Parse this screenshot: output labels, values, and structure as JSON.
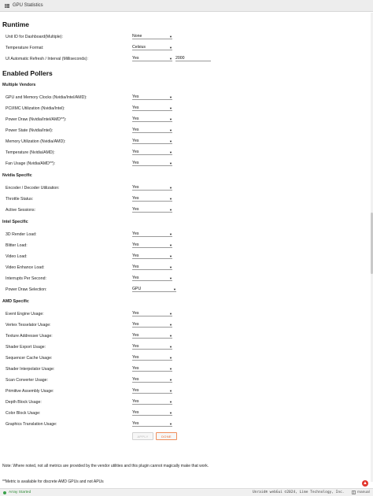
{
  "window": {
    "title": "GPU Statistics"
  },
  "runtime": {
    "heading": "Runtime",
    "rows": [
      {
        "label": "Unit ID for Dashboard(Multiple):",
        "value": "None"
      },
      {
        "label": "Temperature Format:",
        "value": "Celsius"
      },
      {
        "label": "UI Automatic Refresh / Interval (Milliseconds):",
        "value": "Yes",
        "interval": "2000"
      }
    ]
  },
  "pollers": {
    "heading": "Enabled Pollers",
    "multiple": {
      "heading": "Multiple Vendors",
      "rows": [
        {
          "label": "GPU and Memory Clocks (Nvidia/Intel/AMD):",
          "value": "Yes"
        },
        {
          "label": "PCI/IMC Utilization (Nvidia/Intel):",
          "value": "Yes"
        },
        {
          "label": "Power Draw (Nvidia/Intel/AMD**):",
          "value": "Yes"
        },
        {
          "label": "Power State (Nvidia/Intel):",
          "value": "Yes"
        },
        {
          "label": "Memory Utilization (Nvidia/AMD):",
          "value": "Yes"
        },
        {
          "label": "Temperature (Nvidia/AMD):",
          "value": "Yes"
        },
        {
          "label": "Fan Usage (Nvidia/AMD**):",
          "value": "Yes"
        }
      ]
    },
    "nvidia": {
      "heading": "Nvidia Specific",
      "rows": [
        {
          "label": "Encoder / Decoder Utilization:",
          "value": "Yes"
        },
        {
          "label": "Throttle Status:",
          "value": "Yes"
        },
        {
          "label": "Active Sessions:",
          "value": "Yes"
        }
      ]
    },
    "intel": {
      "heading": "Intel Specific",
      "rows": [
        {
          "label": "3D Render Load:",
          "value": "Yes"
        },
        {
          "label": "Blitter Load:",
          "value": "Yes"
        },
        {
          "label": "Video Load:",
          "value": "Yes"
        },
        {
          "label": "Video Enhance Load:",
          "value": "Yes"
        },
        {
          "label": "Interrupts Per Second:",
          "value": "Yes"
        },
        {
          "label": "Power Draw Selection:",
          "value": "GPU"
        }
      ]
    },
    "amd": {
      "heading": "AMD Specific",
      "rows": [
        {
          "label": "Event Engine Usage:",
          "value": "Yes"
        },
        {
          "label": "Vertex Tesselator Usage:",
          "value": "Yes"
        },
        {
          "label": "Texture Addresser Usage:",
          "value": "Yes"
        },
        {
          "label": "Shader Export Usage:",
          "value": "Yes"
        },
        {
          "label": "Sequencer Cache Usage:",
          "value": "Yes"
        },
        {
          "label": "Shader Interpolator Usage:",
          "value": "Yes"
        },
        {
          "label": "Scan Converter Usage:",
          "value": "Yes"
        },
        {
          "label": "Primitive Assembly Usage:",
          "value": "Yes"
        },
        {
          "label": "Depth Block Usage:",
          "value": "Yes"
        },
        {
          "label": "Color Block Usage:",
          "value": "Yes"
        },
        {
          "label": "Graphics Translation Usage:",
          "value": "Yes"
        }
      ]
    }
  },
  "buttons": {
    "apply": "APPLY",
    "done": "DONE"
  },
  "notes": {
    "note1": "Note: Where noted, not all metrics are provided by the vendor utilities and this plugin cannot magically make that work.",
    "note2": "**Metric is available for discrete AMD GPUs and not APUs"
  },
  "footer": {
    "status": "Array Started",
    "copyright": "Unraid® webGui ©2024, Lime Technology, Inc.",
    "manual": "manual"
  },
  "icons": {
    "title": "table-icon",
    "status": "status-dot-icon",
    "manual": "book-icon",
    "scroll_top": "arrow-up-icon"
  },
  "colors": {
    "accent": "#e8652a",
    "status_ok": "#3aa04a",
    "scroll_top": "#e2352c"
  }
}
